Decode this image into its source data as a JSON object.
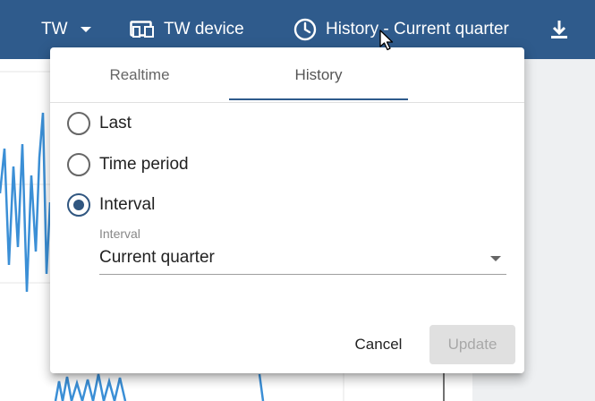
{
  "topbar": {
    "entity_label": "TW",
    "device_label": "TW device",
    "history_label": "History - Current quarter",
    "icons": [
      "chevron-down-icon",
      "devices-icon",
      "clock-icon",
      "download-icon"
    ]
  },
  "popup": {
    "tabs": [
      {
        "label": "Realtime",
        "active": false
      },
      {
        "label": "History",
        "active": true
      }
    ],
    "options": [
      {
        "label": "Last",
        "checked": false
      },
      {
        "label": "Time period",
        "checked": false
      },
      {
        "label": "Interval",
        "checked": true
      }
    ],
    "interval_field": {
      "label": "Interval",
      "value": "Current quarter"
    },
    "cancel_label": "Cancel",
    "update_label": "Update"
  },
  "colors": {
    "topbar": "#2f5b8c",
    "accent": "#305680",
    "chart_line": "#3b8fd6"
  }
}
